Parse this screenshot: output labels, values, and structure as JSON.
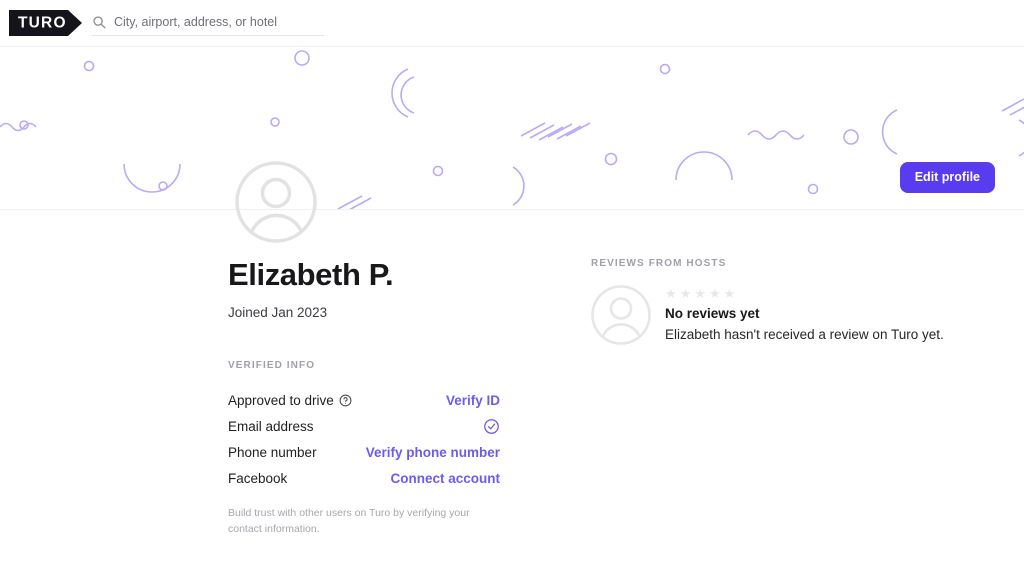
{
  "header": {
    "logo_text": "TURO",
    "logo_icon": "turo-pennant-logo",
    "search_icon": "search-icon",
    "search_placeholder": "City, airport, address, or hotel",
    "search_value": ""
  },
  "banner": {
    "edit_profile_label": "Edit profile",
    "accent_color": "#593cf0",
    "decoration_color": "#b9a9f7"
  },
  "profile": {
    "avatar_icon": "user-avatar-placeholder",
    "name": "Elizabeth P.",
    "joined": "Joined Jan 2023",
    "verified_info_label": "Verified info",
    "rows": [
      {
        "label": "Approved to drive",
        "icon": "help-circle-icon",
        "action": "Verify ID",
        "action_type": "link"
      },
      {
        "label": "Email address",
        "icon": "",
        "action": "",
        "action_type": "verified-check"
      },
      {
        "label": "Phone number",
        "icon": "",
        "action": "Verify phone number",
        "action_type": "link"
      },
      {
        "label": "Facebook",
        "icon": "",
        "action": "Connect account",
        "action_type": "link"
      }
    ],
    "note": "Build trust with other users on Turo by verifying your contact information."
  },
  "reviews": {
    "section_label": "Reviews from hosts",
    "avatar_icon": "user-avatar-placeholder",
    "star_count": 5,
    "star_filled": 0,
    "star_glyph": "★",
    "title": "No reviews yet",
    "text": "Elizabeth hasn't received a review on Turo yet."
  }
}
